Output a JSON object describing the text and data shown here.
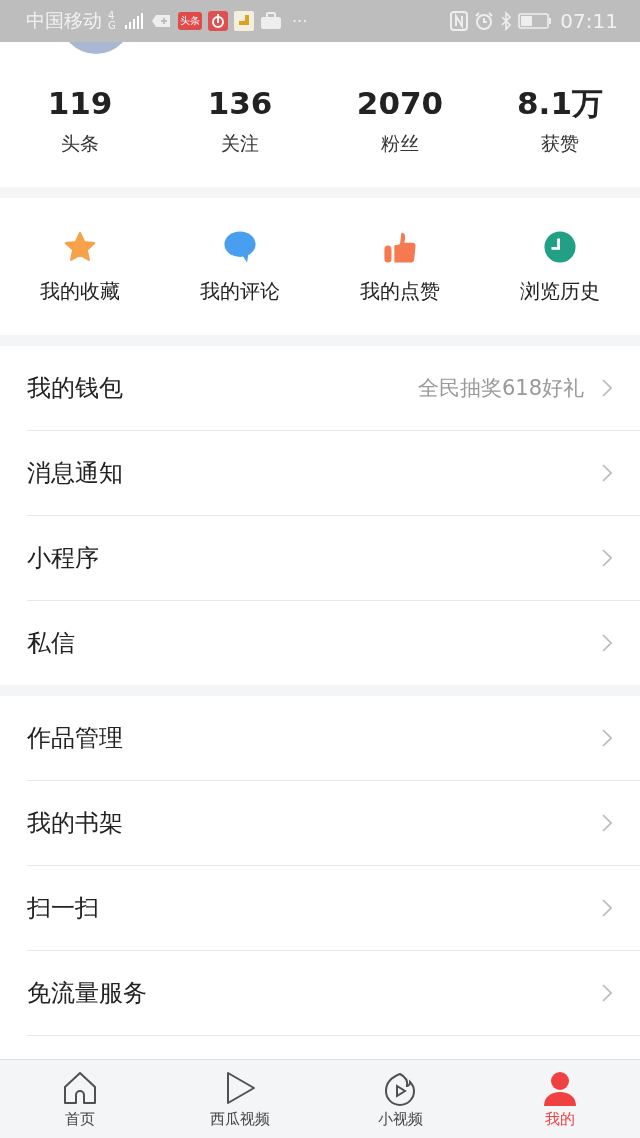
{
  "status_bar": {
    "carrier": "中国移动",
    "network": "4G",
    "app_badge": "头条",
    "more": "···",
    "time": "07:11"
  },
  "stats": [
    {
      "value": "119",
      "label": "头条"
    },
    {
      "value": "136",
      "label": "关注"
    },
    {
      "value": "2070",
      "label": "粉丝"
    },
    {
      "value": "8.1万",
      "label": "获赞"
    }
  ],
  "shortcuts": [
    {
      "kind": "star",
      "label": "我的收藏"
    },
    {
      "kind": "comment",
      "label": "我的评论"
    },
    {
      "kind": "like",
      "label": "我的点赞"
    },
    {
      "kind": "history",
      "label": "浏览历史"
    }
  ],
  "menu_groups": [
    [
      {
        "label": "我的钱包",
        "hint": "全民抽奖618好礼"
      },
      {
        "label": "消息通知"
      },
      {
        "label": "小程序"
      },
      {
        "label": "私信"
      }
    ],
    [
      {
        "label": "作品管理"
      },
      {
        "label": "我的书架"
      },
      {
        "label": "扫一扫"
      },
      {
        "label": "免流量服务"
      }
    ]
  ],
  "tabs": [
    {
      "kind": "home",
      "label": "首页",
      "selected": false
    },
    {
      "kind": "play",
      "label": "西瓜视频",
      "selected": false
    },
    {
      "kind": "flame",
      "label": "小视频",
      "selected": false
    },
    {
      "kind": "user",
      "label": "我的",
      "selected": true
    }
  ]
}
